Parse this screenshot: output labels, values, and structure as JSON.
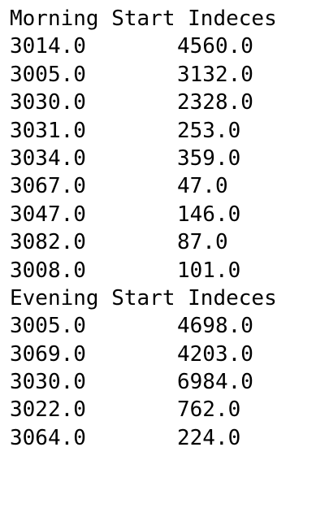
{
  "sections": [
    {
      "heading": "Morning Start Indeces",
      "rows": [
        [
          "3014.0",
          "4560.0"
        ],
        [
          "3005.0",
          "3132.0"
        ],
        [
          "3030.0",
          "2328.0"
        ],
        [
          "3031.0",
          "253.0"
        ],
        [
          "3034.0",
          "359.0"
        ],
        [
          "3067.0",
          "47.0"
        ],
        [
          "3047.0",
          "146.0"
        ],
        [
          "3082.0",
          "87.0"
        ],
        [
          "3008.0",
          "101.0"
        ]
      ]
    },
    {
      "heading": "Evening Start Indeces",
      "rows": [
        [
          "3005.0",
          "4698.0"
        ],
        [
          "3069.0",
          "4203.0"
        ],
        [
          "3030.0",
          "6984.0"
        ],
        [
          "3022.0",
          "762.0"
        ],
        [
          "3064.0",
          "224.0"
        ]
      ]
    }
  ]
}
